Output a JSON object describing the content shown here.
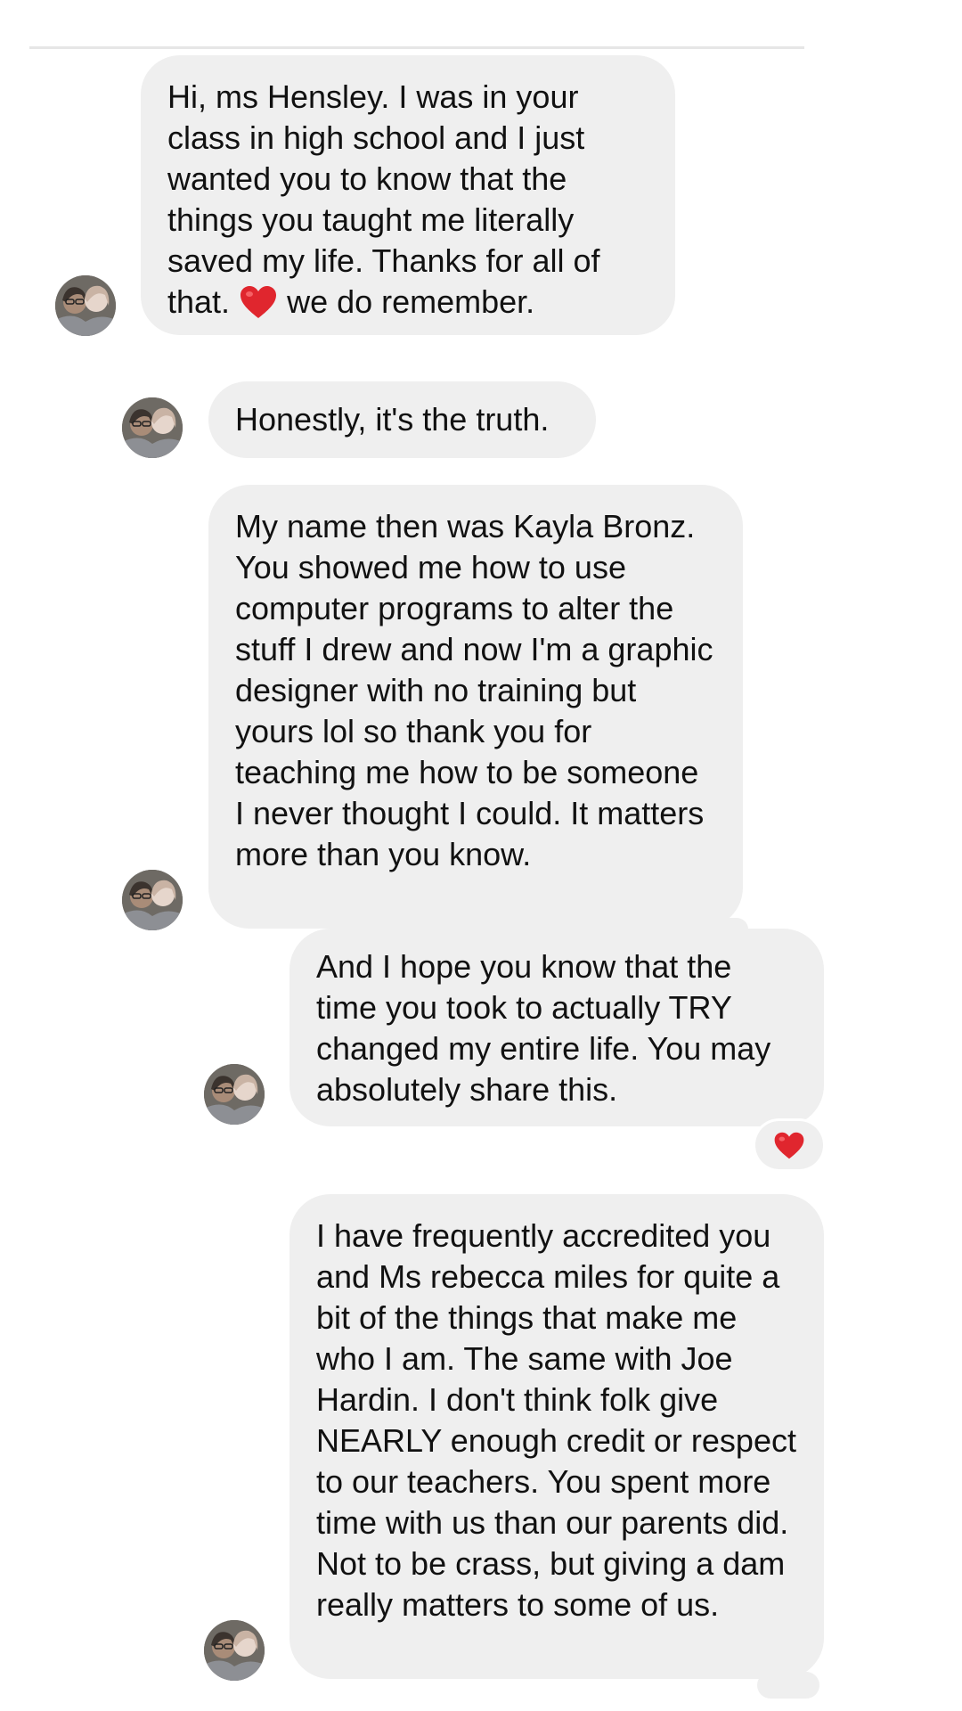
{
  "thread": {
    "messages": [
      {
        "text": "Hi, ms Hensley. I was in your class in high school and I just wanted you to know that the things you taught me literally saved my life. Thanks for all of",
        "text_tail_before": "that. ",
        "text_tail_after": " we do remember."
      },
      {
        "text": "Honestly, it's the truth."
      },
      {
        "text": "My name then was Kayla Bronz. You showed me how to use computer programs to alter the stuff I drew and now I'm a graphic designer with no training but yours lol so thank you for teaching me how to be someone I never thought I could. It matters more than you know."
      },
      {
        "text": "And I hope you know that the time you took to actually TRY changed my entire life. You may absolutely share this."
      },
      {
        "text": "I have frequently accredited you and Ms rebecca miles for quite a bit of the things that make me who I am. The same with Joe Hardin. I don't think folk give NEARLY enough credit or respect to our teachers. You spent more time with us than our parents did. Not to be crass, but giving a dam really matters to some of us."
      }
    ],
    "reaction_icon": "heart-emoji",
    "avatar_icon": "profile-photo",
    "colors": {
      "bubble": "#efefef",
      "heart": "#e0262e",
      "text": "#111111"
    }
  }
}
